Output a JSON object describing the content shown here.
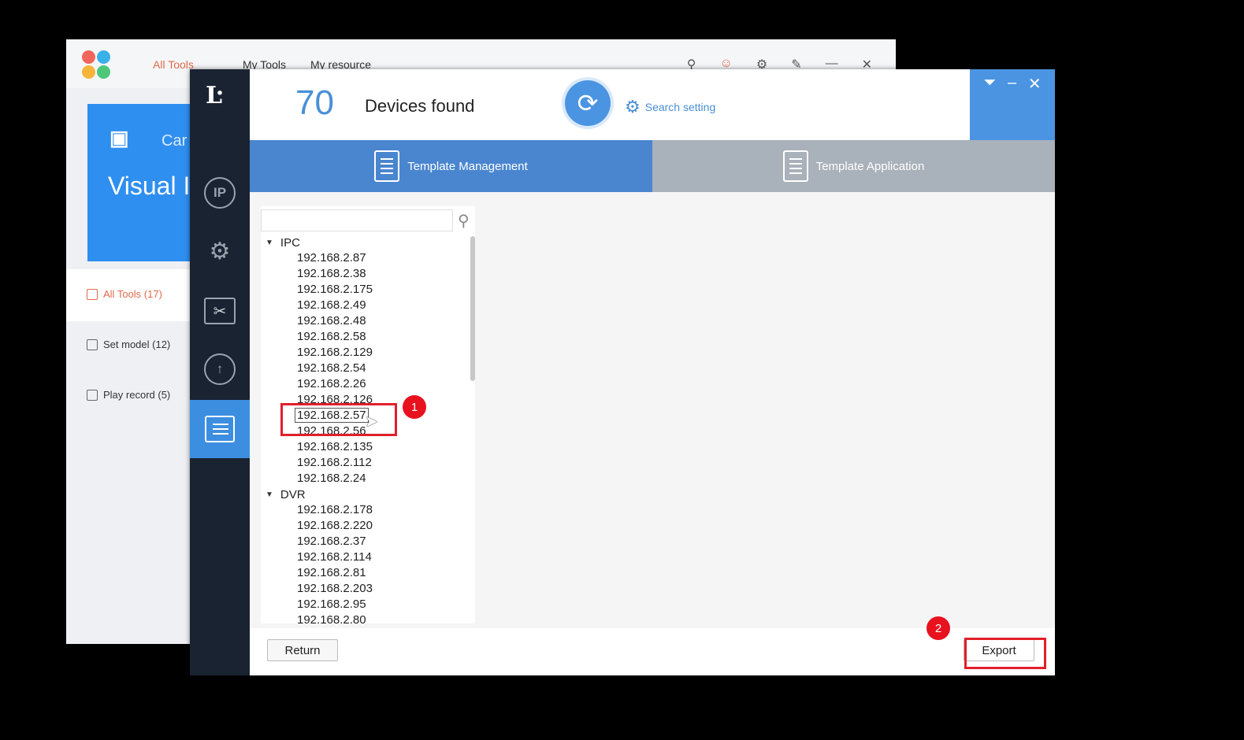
{
  "background_app": {
    "nav": [
      "All Tools",
      "My Tools",
      "My resource"
    ],
    "banner_small": "Car",
    "banner_title": "Visual Image F",
    "sidebar": [
      {
        "label": "All Tools (17)"
      },
      {
        "label": "Set model (12)"
      },
      {
        "label": "Play record (5)"
      }
    ]
  },
  "header": {
    "count": "70",
    "found_label": "Devices found",
    "search_setting": "Search setting"
  },
  "tabs": [
    {
      "label": "Template Management",
      "active": true
    },
    {
      "label": "Template Application",
      "active": false
    }
  ],
  "tree": {
    "search_placeholder": "",
    "groups": [
      {
        "name": "IPC",
        "items": [
          "192.168.2.87",
          "192.168.2.38",
          "192.168.2.175",
          "192.168.2.49",
          "192.168.2.48",
          "192.168.2.58",
          "192.168.2.129",
          "192.168.2.54",
          "192.168.2.26",
          "192.168.2.126",
          "192.168.2.57",
          "192.168.2.56",
          "192.168.2.135",
          "192.168.2.112",
          "192.168.2.24"
        ]
      },
      {
        "name": "DVR",
        "items": [
          "192.168.2.178",
          "192.168.2.220",
          "192.168.2.37",
          "192.168.2.114",
          "192.168.2.81",
          "192.168.2.203",
          "192.168.2.95",
          "192.168.2.80"
        ]
      }
    ],
    "selected": "192.168.2.57"
  },
  "buttons": {
    "return": "Return",
    "export": "Export"
  },
  "annotations": {
    "step1": "1",
    "step2": "2"
  },
  "colors": {
    "accent": "#4a94e2",
    "rail": "#1a2332",
    "annotation": "#e0202a"
  }
}
